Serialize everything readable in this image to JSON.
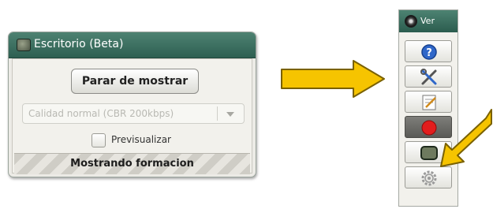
{
  "panel": {
    "title": "Escritorio (Beta)",
    "stop_button_label": "Parar de mostrar",
    "quality_select_value": "Calidad normal (CBR 200kbps)",
    "preview_label": "Previsualizar",
    "preview_checked": false,
    "status_text": "Mostrando formacion"
  },
  "toolbar": {
    "title": "Ver",
    "buttons": [
      {
        "icon": "help-icon"
      },
      {
        "icon": "tools-icon"
      },
      {
        "icon": "notes-icon"
      },
      {
        "icon": "record-icon"
      },
      {
        "icon": "desktop-share-icon",
        "active": true
      },
      {
        "icon": "settings-icon"
      }
    ]
  },
  "colors": {
    "header_green": "#2e5f51",
    "arrow_yellow": "#f6c400",
    "record_red": "#e21d1d",
    "help_blue": "#2f67c9"
  }
}
